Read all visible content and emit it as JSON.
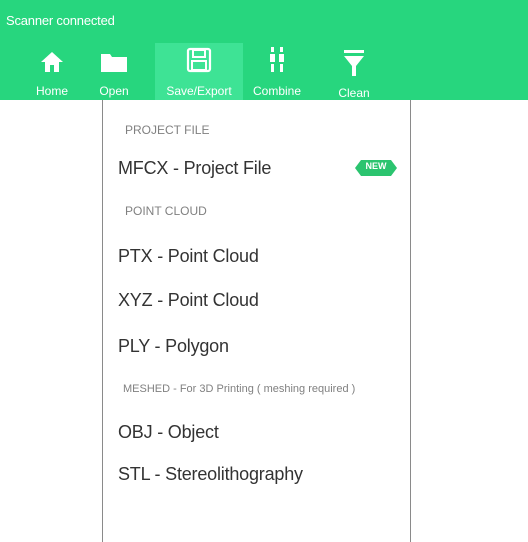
{
  "status": "Scanner connected",
  "toolbar": {
    "items": [
      {
        "label": "Home",
        "icon": "home-icon"
      },
      {
        "label": "Open",
        "icon": "folder-icon"
      },
      {
        "label": "Save/Export",
        "icon": "save-icon"
      },
      {
        "label": "Combine",
        "icon": "combine-icon"
      },
      {
        "label": "Clean",
        "icon": "filter-icon"
      }
    ],
    "active": "Save/Export"
  },
  "menu": {
    "sections": {
      "project": "PROJECT FILE",
      "point_cloud": "POINT CLOUD",
      "meshed": "MESHED - For 3D Printing  ( meshing required )"
    },
    "items": {
      "mfcx": "MFCX - Project File",
      "ptx": "PTX - Point Cloud",
      "xyz": "XYZ - Point Cloud",
      "ply": "PLY - Polygon",
      "obj": "OBJ - Object",
      "stl": "STL - Stereolithography"
    },
    "badge": "NEW"
  },
  "colors": {
    "accent": "#27d67e",
    "active_tab": "#3ee395",
    "badge": "#2bc46f"
  }
}
